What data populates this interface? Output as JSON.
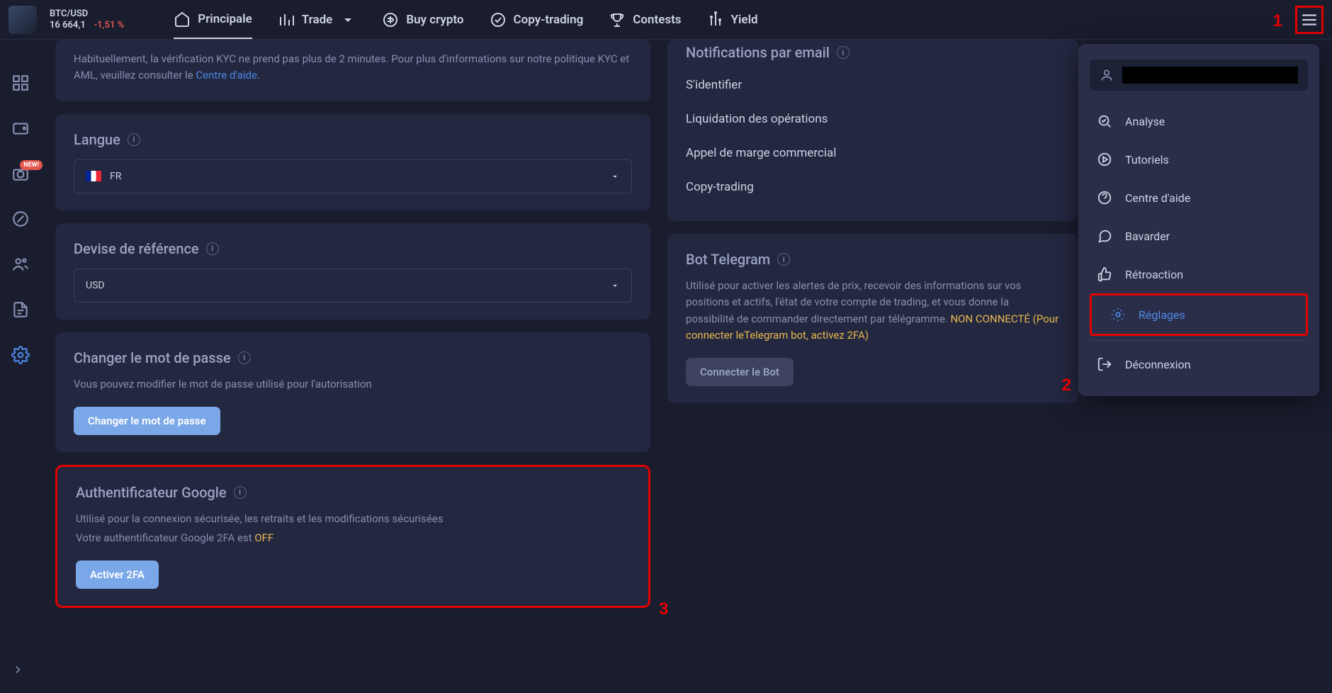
{
  "ticker": {
    "pair": "BTC/USD",
    "price": "16 664,1",
    "change": "-1,51 %"
  },
  "nav": {
    "principale": "Principale",
    "trade": "Trade",
    "buy_crypto": "Buy crypto",
    "copy_trading": "Copy-trading",
    "contests": "Contests",
    "yield": "Yield"
  },
  "rail": {
    "badge_new": "NEW!"
  },
  "kyc": {
    "desc_prefix": "Habituellement, la vérification KYC ne prend pas plus de 2 minutes. Pour plus d'informations sur notre politique KYC et AML, veuillez consulter le ",
    "link": "Centre d'aide",
    "suffix": "."
  },
  "lang": {
    "title": "Langue",
    "value": "FR"
  },
  "currency": {
    "title": "Devise de référence",
    "value": "USD"
  },
  "password": {
    "title": "Changer le mot de passe",
    "desc": "Vous pouvez modifier le mot de passe utilisé pour l'autorisation",
    "btn": "Changer le mot de passe"
  },
  "g2fa": {
    "title": "Authentificateur Google",
    "desc1": "Utilisé pour la connexion sécurisée, les retraits et les modifications sécurisées",
    "desc2_prefix": "Votre authentificateur Google 2FA est ",
    "desc2_status": "OFF",
    "btn": "Activer 2FA"
  },
  "notifications": {
    "title": "Notifications par email",
    "items": [
      "S'identifier",
      "Liquidation des opérations",
      "Appel de marge commercial",
      "Copy-trading"
    ]
  },
  "telegram": {
    "title": "Bot Telegram",
    "desc_prefix": "Utilisé pour activer les alertes de prix, recevoir des informations sur vos positions et actifs, l'état de votre compte de trading, et vous donne la possibilité de commander directement par télégramme. ",
    "warn": "NON CONNECTÉ (Pour connecter leTelegram bot, activez 2FA)",
    "btn": "Connecter le Bot"
  },
  "dropdown": {
    "analyse": "Analyse",
    "tutoriels": "Tutoriels",
    "aide": "Centre d'aide",
    "bavarder": "Bavarder",
    "retroaction": "Rétroaction",
    "reglages": "Réglages",
    "deconnexion": "Déconnexion"
  },
  "annotations": {
    "one": "1",
    "two": "2",
    "three": "3"
  }
}
